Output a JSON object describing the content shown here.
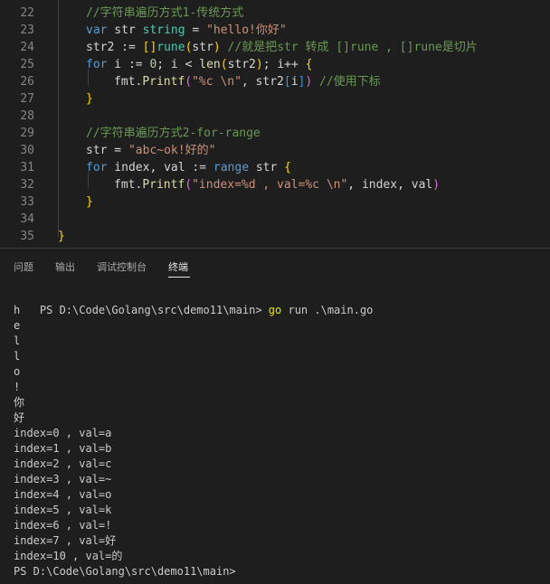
{
  "editor": {
    "lines": [
      {
        "num": "22",
        "indent": 1,
        "tokens": [
          {
            "t": "//字符串遍历方式1-传统方式",
            "c": "c"
          }
        ]
      },
      {
        "num": "23",
        "indent": 1,
        "tokens": [
          {
            "t": "var",
            "c": "k"
          },
          {
            "t": " str ",
            "c": "p"
          },
          {
            "t": "string",
            "c": "ty"
          },
          {
            "t": " = ",
            "c": "p"
          },
          {
            "t": "\"hello!你好\"",
            "c": "s"
          }
        ]
      },
      {
        "num": "24",
        "indent": 1,
        "tokens": [
          {
            "t": "str2 := ",
            "c": "p"
          },
          {
            "t": "[]",
            "c": "b1"
          },
          {
            "t": "rune",
            "c": "ty"
          },
          {
            "t": "(",
            "c": "b1"
          },
          {
            "t": "str",
            "c": "p"
          },
          {
            "t": ")",
            "c": "b1"
          },
          {
            "t": " //就是把str 转成 []rune , []rune是切片",
            "c": "c"
          }
        ]
      },
      {
        "num": "25",
        "indent": 1,
        "tokens": [
          {
            "t": "for",
            "c": "k"
          },
          {
            "t": " i := ",
            "c": "p"
          },
          {
            "t": "0",
            "c": "n"
          },
          {
            "t": "; i < ",
            "c": "p"
          },
          {
            "t": "len",
            "c": "f"
          },
          {
            "t": "(",
            "c": "b1"
          },
          {
            "t": "str2",
            "c": "p"
          },
          {
            "t": ")",
            "c": "b1"
          },
          {
            "t": "; i++ ",
            "c": "p"
          },
          {
            "t": "{",
            "c": "b1"
          }
        ]
      },
      {
        "num": "26",
        "indent": 2,
        "tokens": [
          {
            "t": "fmt.",
            "c": "p"
          },
          {
            "t": "Printf",
            "c": "f"
          },
          {
            "t": "(",
            "c": "b2"
          },
          {
            "t": "\"%c \\n\"",
            "c": "s"
          },
          {
            "t": ", str2",
            "c": "p"
          },
          {
            "t": "[",
            "c": "b3"
          },
          {
            "t": "i",
            "c": "p"
          },
          {
            "t": "]",
            "c": "b3"
          },
          {
            "t": ")",
            "c": "b2"
          },
          {
            "t": " //使用下标",
            "c": "c"
          }
        ]
      },
      {
        "num": "27",
        "indent": 1,
        "tokens": [
          {
            "t": "}",
            "c": "b1"
          }
        ]
      },
      {
        "num": "28",
        "indent": 0,
        "tokens": []
      },
      {
        "num": "29",
        "indent": 1,
        "tokens": [
          {
            "t": "//字符串遍历方式2-for-range",
            "c": "c"
          }
        ]
      },
      {
        "num": "30",
        "indent": 1,
        "tokens": [
          {
            "t": "str = ",
            "c": "p"
          },
          {
            "t": "\"abc~ok!好的\"",
            "c": "s"
          }
        ]
      },
      {
        "num": "31",
        "indent": 1,
        "tokens": [
          {
            "t": "for",
            "c": "k"
          },
          {
            "t": " index, val := ",
            "c": "p"
          },
          {
            "t": "range",
            "c": "k"
          },
          {
            "t": " str ",
            "c": "p"
          },
          {
            "t": "{",
            "c": "b1"
          }
        ]
      },
      {
        "num": "32",
        "indent": 2,
        "tokens": [
          {
            "t": "fmt.",
            "c": "p"
          },
          {
            "t": "Printf",
            "c": "f"
          },
          {
            "t": "(",
            "c": "b2"
          },
          {
            "t": "\"index=%d , val=%c \\n\"",
            "c": "s"
          },
          {
            "t": ", index, val",
            "c": "p"
          },
          {
            "t": ")",
            "c": "b2"
          }
        ]
      },
      {
        "num": "33",
        "indent": 1,
        "tokens": [
          {
            "t": "}",
            "c": "b1"
          }
        ]
      },
      {
        "num": "34",
        "indent": 0,
        "tokens": []
      },
      {
        "num": "35",
        "indent": 0,
        "tokens": [
          {
            "t": "}",
            "c": "b1"
          }
        ]
      }
    ]
  },
  "panel": {
    "tabs": [
      {
        "label": "问题",
        "active": false
      },
      {
        "label": "输出",
        "active": false
      },
      {
        "label": "调试控制台",
        "active": false
      },
      {
        "label": "终端",
        "active": true
      }
    ]
  },
  "terminal": {
    "prompt": "PS D:\\Code\\Golang\\src\\demo11\\main>",
    "command": "go",
    "command_args": "run .\\main.go",
    "output": [
      "h",
      "e",
      "l",
      "l",
      "o",
      "!",
      "你",
      "好",
      "index=0 , val=a",
      "index=1 , val=b",
      "index=2 , val=c",
      "index=3 , val=~",
      "index=4 , val=o",
      "index=5 , val=k",
      "index=6 , val=!",
      "index=7 , val=好",
      "index=10 , val=的"
    ],
    "final_prompt": "PS D:\\Code\\Golang\\src\\demo11\\main>"
  }
}
